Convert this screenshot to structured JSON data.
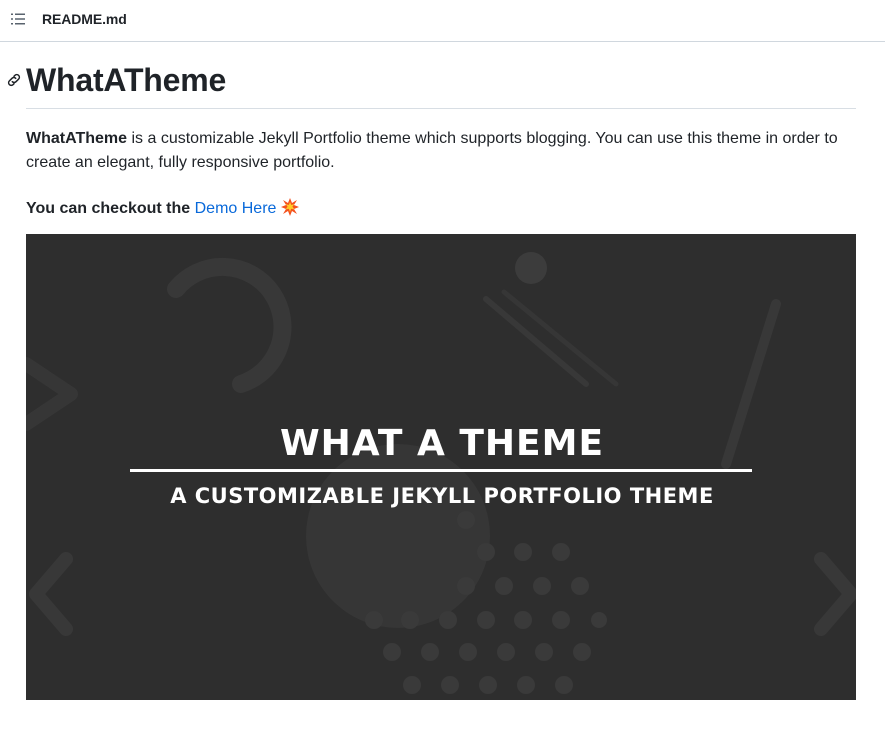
{
  "file_bar": {
    "toc_icon": "list-unordered-icon",
    "file_name": "README.md"
  },
  "readme": {
    "anchor_icon": "link-icon",
    "title": "WhatATheme",
    "intro": {
      "bold": "WhatATheme",
      "rest": " is a customizable Jekyll Portfolio theme which supports blogging. You can use this theme in order to create an elegant, fully responsive portfolio."
    },
    "demo": {
      "prefix": "You can checkout the ",
      "link_text": "Demo Here",
      "emoji_icon": "collision-icon"
    },
    "banner": {
      "title": "WHAT A THEME",
      "subtitle": "A CUSTOMIZABLE JEKYLL PORTFOLIO THEME"
    }
  },
  "colors": {
    "link": "#0969da",
    "text": "#1f2328",
    "border": "#d0d7de",
    "banner_bg": "#2e2e2e"
  }
}
